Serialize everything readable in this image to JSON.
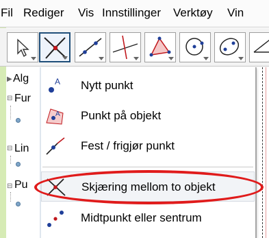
{
  "menubar": {
    "items": [
      "Fil",
      "Rediger",
      "Vis",
      "Innstillinger",
      "Verktøy",
      "Vin"
    ]
  },
  "toolbar": {
    "tools": [
      {
        "icon": "move-arrow-icon"
      },
      {
        "icon": "intersect-icon",
        "active": true
      },
      {
        "icon": "line-icon"
      },
      {
        "icon": "perpendicular-icon"
      },
      {
        "icon": "polygon-icon"
      },
      {
        "icon": "circle-center-point-icon"
      },
      {
        "icon": "conic-icon"
      },
      {
        "icon": "angle-icon"
      }
    ]
  },
  "algebra": {
    "rows": [
      "Alg",
      "Fur",
      "Lin",
      "Pu"
    ]
  },
  "popup": {
    "items": [
      {
        "label": "Nytt punkt",
        "icon": "new-point-icon"
      },
      {
        "label": "Punkt på objekt",
        "icon": "point-on-object-icon"
      },
      {
        "label": "Fest / frigjør punkt",
        "icon": "attach-detach-point-icon"
      },
      {
        "label": "Skjæring mellom to objekt",
        "icon": "intersect-icon",
        "highlighted": true
      },
      {
        "label": "Midtpunkt eller sentrum",
        "icon": "midpoint-icon"
      }
    ]
  },
  "colors": {
    "accent_strip": "#d6ebb5",
    "active_border": "#1f4e79",
    "annotation_ellipse": "#e01b1b"
  }
}
